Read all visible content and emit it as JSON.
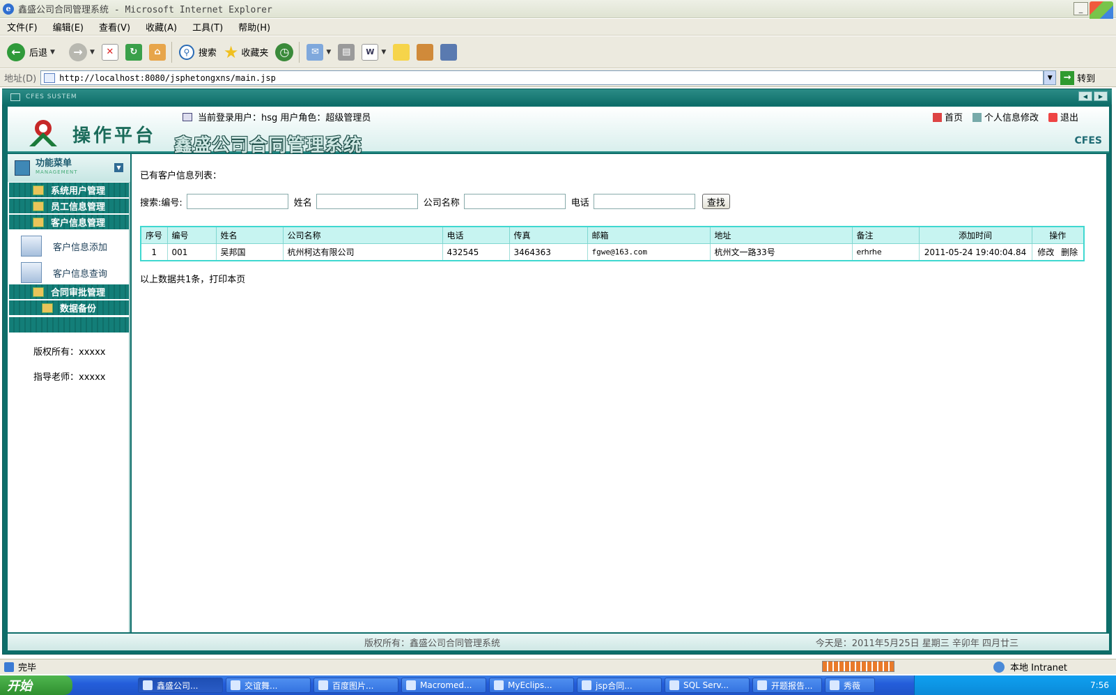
{
  "window": {
    "title": "鑫盛公司合同管理系统 - Microsoft Internet Explorer",
    "controls": [
      "_",
      "□"
    ]
  },
  "menu": [
    "文件(F)",
    "编辑(E)",
    "查看(V)",
    "收藏(A)",
    "工具(T)",
    "帮助(H)"
  ],
  "toolbar": {
    "back": "后退",
    "search": "搜索",
    "favorites": "收藏夹"
  },
  "address": {
    "label": "地址(D)",
    "url": "http://localhost:8080/jsphetongxns/main.jsp",
    "go": "转到"
  },
  "app": {
    "system_label": "CFES SUSTEM",
    "logo_text": "操作平台",
    "title": "鑫盛公司合同管理系统",
    "user_info": "当前登录用户：hsg   用户角色：超级管理员",
    "links": {
      "home": "首页",
      "profile": "个人信息修改",
      "logout": "退出"
    },
    "brand": "CFES"
  },
  "sidebar": {
    "head_title": "功能菜单",
    "head_sub": "MANAGEMENT",
    "items": [
      "系统用户管理",
      "员工信息管理",
      "客户信息管理",
      "合同审批管理",
      "数据备份"
    ],
    "subitems": [
      "客户信息添加",
      "客户信息查询"
    ],
    "copyright": "版权所有：xxxxx",
    "teacher": "指导老师：xxxxx"
  },
  "main": {
    "list_title": "已有客户信息列表：",
    "search": {
      "label_id": "搜索:编号:",
      "label_name": "姓名",
      "label_company": "公司名称",
      "label_phone": "电话",
      "button": "查找"
    },
    "table": {
      "headers": [
        "序号",
        "编号",
        "姓名",
        "公司名称",
        "电话",
        "传真",
        "邮箱",
        "地址",
        "备注",
        "添加时间",
        "操作"
      ],
      "rows": [
        {
          "seq": "1",
          "id": "001",
          "name": "吴邦国",
          "company": "杭州柯达有限公司",
          "phone": "432545",
          "fax": "3464363",
          "email": "fgwe@163.com",
          "address": "杭州文一路33号",
          "note": "erhrhe",
          "time": "2011-05-24 19:40:04.84",
          "edit": "修改",
          "delete": "删除"
        }
      ]
    },
    "summary": "以上数据共1条，打印本页"
  },
  "footer": {
    "copyright": "版权所有：鑫盛公司合同管理系统",
    "date": "今天是：2011年5月25日 星期三 辛卯年 四月廿三"
  },
  "statusbar": {
    "status": "完毕",
    "zone": "本地 Intranet"
  },
  "taskbar": {
    "start": "开始",
    "tasks": [
      "鑫盛公司...",
      "交谊舞...",
      "百度图片...",
      "Macromed...",
      "MyEclips...",
      "jsp合同...",
      "SQL Serv...",
      "开题报告...",
      "秀薇"
    ],
    "clock": "7:56"
  }
}
